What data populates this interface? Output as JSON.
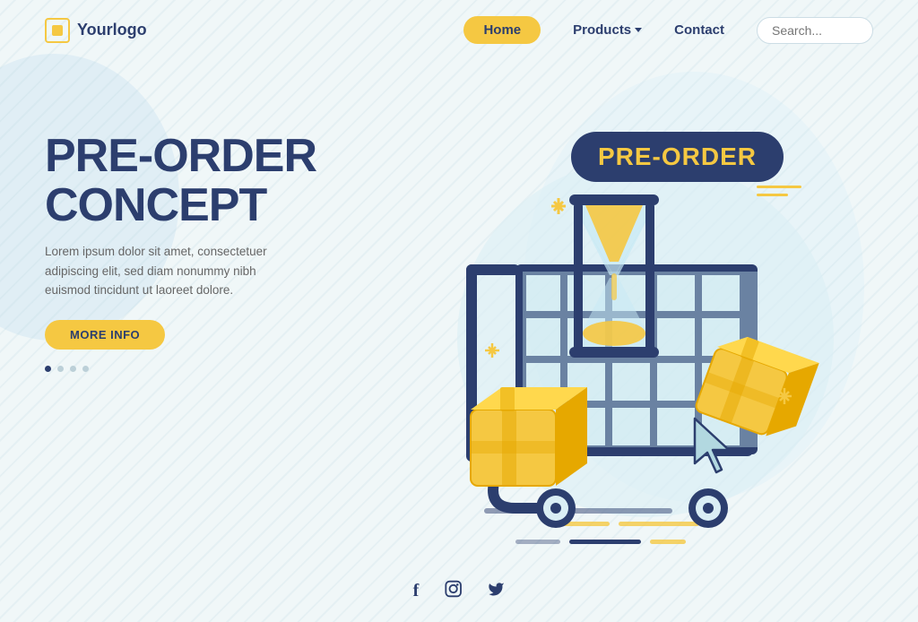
{
  "logo": {
    "text": "Yourlogo"
  },
  "navbar": {
    "home_label": "Home",
    "products_label": "Products",
    "contact_label": "Contact",
    "search_placeholder": "Search..."
  },
  "hero": {
    "title_line1": "PRE-ORDER",
    "title_line2": "CONCEPT",
    "description": "Lorem ipsum dolor sit amet, consectetuer adipiscing elit, sed diam nonummy nibh euismod tincidunt ut laoreet dolore.",
    "cta_label": "MORE INFO"
  },
  "preorder_badge": "PRE-ORDER",
  "footer": {
    "social": {
      "facebook": "f",
      "instagram": "⊙",
      "twitter": "𝕏"
    }
  },
  "colors": {
    "yellow": "#f5c842",
    "dark_navy": "#2c3e6e",
    "light_teal": "#b2d8e0",
    "bg": "#f0f7f8"
  }
}
